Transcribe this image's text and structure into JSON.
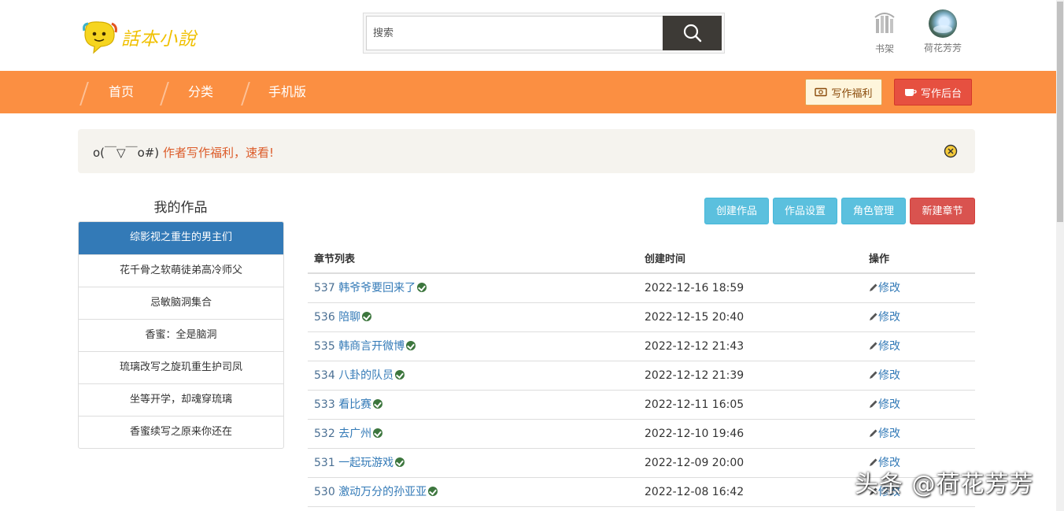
{
  "header": {
    "logo_text": "話本小說",
    "search": {
      "placeholder": "搜索",
      "value": ""
    },
    "bookshelf_label": "书架",
    "user_name": "荷花芳芳"
  },
  "nav": {
    "items": [
      {
        "label": "首页"
      },
      {
        "label": "分类"
      },
      {
        "label": "手机版"
      }
    ],
    "welfare_label": "写作福利",
    "backend_label": "写作后台"
  },
  "notice": {
    "face": "o(￣▽￣o#)",
    "text": "作者写作福利，速看!"
  },
  "works": {
    "title": "我的作品",
    "items": [
      {
        "label": "综影视之重生的男主们",
        "active": true
      },
      {
        "label": "花千骨之软萌徒弟高冷师父"
      },
      {
        "label": "忌敏脑洞集合"
      },
      {
        "label": "香蜜：全是脑洞"
      },
      {
        "label": "琉璃改写之旋玑重生护司凤"
      },
      {
        "label": "坐等开学，却魂穿琉璃"
      },
      {
        "label": "香蜜续写之原来你还在"
      }
    ]
  },
  "actions": {
    "create_work": "创建作品",
    "work_settings": "作品设置",
    "role_manage": "角色管理",
    "new_chapter": "新建章节"
  },
  "chapters": {
    "headers": {
      "list": "章节列表",
      "created": "创建时间",
      "op": "操作"
    },
    "edit_label": "修改",
    "rows": [
      {
        "num": "537",
        "title": "韩爷爷要回来了",
        "time": "2022-12-16 18:59"
      },
      {
        "num": "536",
        "title": "陪聊",
        "time": "2022-12-15 20:40"
      },
      {
        "num": "535",
        "title": "韩商言开微博",
        "time": "2022-12-12 21:43"
      },
      {
        "num": "534",
        "title": "八卦的队员",
        "time": "2022-12-12 21:39"
      },
      {
        "num": "533",
        "title": "看比赛",
        "time": "2022-12-11 16:05"
      },
      {
        "num": "532",
        "title": "去广州",
        "time": "2022-12-10 19:46"
      },
      {
        "num": "531",
        "title": "一起玩游戏",
        "time": "2022-12-09 20:00"
      },
      {
        "num": "530",
        "title": "激动万分的孙亚亚",
        "time": "2022-12-08 16:42"
      }
    ]
  },
  "watermark": "头条 @荷花芳芳",
  "colors": {
    "nav_orange": "#fb8f42",
    "primary_blue": "#337ab7",
    "info": "#5bc0de",
    "danger": "#d9534f"
  }
}
